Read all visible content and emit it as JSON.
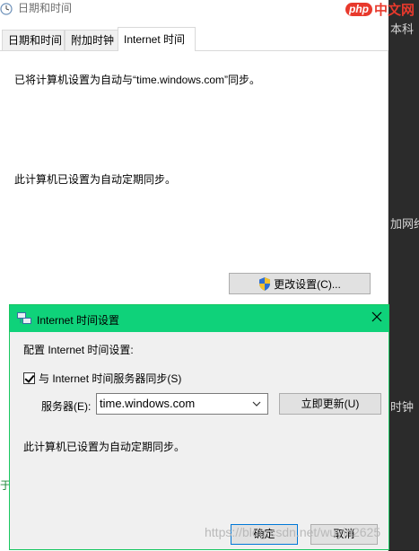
{
  "main_window": {
    "title": "日期和时间",
    "tabs": [
      {
        "label": "日期和时间",
        "active": false
      },
      {
        "label": "附加时钟",
        "active": false
      },
      {
        "label": "Internet 时间",
        "active": true
      }
    ],
    "sync_message": "已将计算机设置为自动与“time.windows.com”同步。",
    "auto_sync_message": "此计算机已设置为自动定期同步。",
    "change_settings_label": "更改设置(C)..."
  },
  "dialog": {
    "title": "Internet 时间设置",
    "config_label": "配置 Internet 时间设置:",
    "sync_checkbox_label": "与 Internet 时间服务器同步(S)",
    "sync_checked": true,
    "server_label": "服务器(E):",
    "server_value": "time.windows.com",
    "update_now_label": "立即更新(U)",
    "status": "此计算机已设置为自动定期同步。",
    "ok_label": "确定",
    "cancel_label": "取消"
  },
  "background": {
    "right_fragments": [
      "本科",
      "加网络",
      "时钟"
    ],
    "left_fragment": "于",
    "logo_badge": "php",
    "logo_text": "中文网",
    "watermark": "https://blog.csdn.net/wuyin2625"
  },
  "colors": {
    "dialog_titlebar": "#0fd27a",
    "button_face": "#e1e1e1",
    "default_button_border": "#0078d7",
    "logo_red": "#e8392c"
  },
  "icons": {
    "window_icon": "clock-icon",
    "dialog_icon": "network-icon",
    "shield_icon": "uac-shield-icon",
    "close_icon": "close-icon",
    "dropdown_icon": "chevron-down-icon"
  }
}
